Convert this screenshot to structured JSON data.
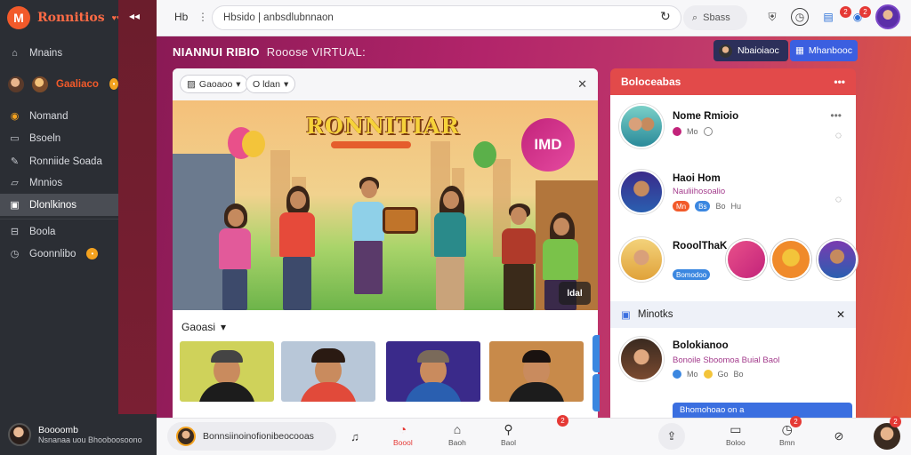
{
  "brand": {
    "name": "Ronnitios",
    "logo_letter": "M"
  },
  "sidebar": {
    "items": [
      {
        "label": "Mnains",
        "icon": "home-icon"
      },
      {
        "label": "Gaaliaco",
        "icon": "avatar",
        "badge": "•"
      },
      {
        "label": "Nomand",
        "icon": "compass-icon"
      },
      {
        "label": "Bsoeln",
        "icon": "inbox-icon"
      },
      {
        "label": "Ronniide Soada",
        "icon": "wrench-icon"
      },
      {
        "label": "Mnnios",
        "icon": "folder-icon"
      },
      {
        "label": "Dlonlkinos",
        "icon": "briefcase-icon",
        "active": true
      },
      {
        "label": "Boola",
        "icon": "minus-box-icon"
      },
      {
        "label": "Goonnlibo",
        "icon": "clock-icon",
        "badge": "•"
      }
    ],
    "user": {
      "name": "Boooomb",
      "subtitle": "Nsnanaa uou Bhooboosoono"
    }
  },
  "topbar": {
    "label": "Hb",
    "address": "Hbsido | anbsdlubnnaon",
    "search_label": "Sbass",
    "icons": [
      "shield-icon",
      "clock-icon",
      "calendar-icon",
      "bell-icon"
    ],
    "badges": [
      "2",
      "2"
    ]
  },
  "main": {
    "title": "NIANNUI RIBIO",
    "title_sub": "Rooose VIRTUAL:",
    "tab_a": "Nbaioiaoc",
    "tab_b": "Mhanbooc"
  },
  "card": {
    "chip_a": "Gaoaoo",
    "chip_b": "O ldan",
    "hero_title": "RONNITIAR",
    "hero_bubble": "IMD",
    "hero_badge": "ldal",
    "section_label": "Gaoasi",
    "thumbs": [
      {
        "bg": "#cfd25a",
        "shirt": "#1c1c1c",
        "cap": "#444444"
      },
      {
        "bg": "#b8c7d8",
        "shirt": "#e14a3a",
        "cap": ""
      },
      {
        "bg": "#3a2a8a",
        "shirt": "#2a5fb0",
        "cap": "#7a6a5a"
      },
      {
        "bg": "#c88a4a",
        "shirt": "#1c1c1c",
        "cap": ""
      }
    ]
  },
  "panel": {
    "title": "Boloceabas",
    "more": "•••",
    "rows": [
      {
        "name": "Nome Rmioio",
        "sub": "",
        "meta": [
          "Mo",
          "ﾑ"
        ],
        "more": "•••"
      },
      {
        "name": "Haoi Hom",
        "sub": "Nauliihosoalio",
        "meta": [
          "Mn",
          "Bs",
          "Bo",
          "Hu"
        ]
      },
      {
        "name": "RooolThaK",
        "sub": "",
        "meta": [
          "Bomodoo"
        ]
      }
    ]
  },
  "panel2": {
    "title": "Minotks",
    "row": {
      "name": "Bolokianoo",
      "sub": "Bonoile Sboomoa Buial Baol",
      "meta": [
        "Mo",
        "Go",
        "Bo"
      ]
    },
    "blue_bar": "Bhomohoao on a"
  },
  "bottombar": {
    "composer": "Bonnsiinoinofionibeocooas",
    "items": [
      {
        "label": "Boool",
        "icon": "bell-icon",
        "active": true
      },
      {
        "label": "Baoh",
        "icon": "home-icon"
      },
      {
        "label": "Baol",
        "icon": "profile-icon"
      }
    ],
    "badge_count": "2",
    "right_badges": [
      "2",
      "2"
    ],
    "right_labels": [
      "Boloo",
      "Bmn"
    ]
  },
  "colors": {
    "accent": "#e53935",
    "brand": "#f25a2a",
    "blue": "#3b6fe0"
  }
}
